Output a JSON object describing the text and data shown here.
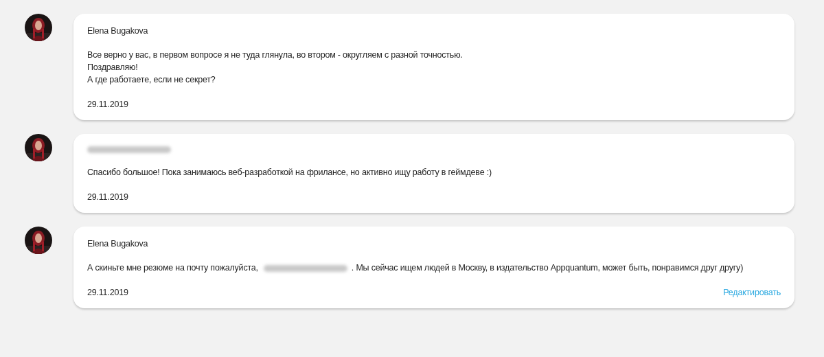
{
  "comments": [
    {
      "author": {
        "kind": "name",
        "text": "Elena Bugakova"
      },
      "lines": [
        [
          {
            "kind": "text",
            "text": "Все верно у вас, в первом вопросе я не туда глянула, во втором - округляем с разной точностью."
          }
        ],
        [
          {
            "kind": "text",
            "text": "Поздравляю!"
          }
        ],
        [
          {
            "kind": "text",
            "text": "А где работаете, если не секрет?"
          }
        ]
      ],
      "date": "29.11.2019"
    },
    {
      "author": {
        "kind": "redacted"
      },
      "lines": [
        [
          {
            "kind": "text",
            "text": "Спасибо большое! Пока занимаюсь веб-разработкой на фрилансе, но активно ищу работу в геймдеве :)"
          }
        ]
      ],
      "date": "29.11.2019"
    },
    {
      "author": {
        "kind": "name",
        "text": "Elena Bugakova"
      },
      "lines": [
        [
          {
            "kind": "text",
            "text": "А скиньте мне резюме на почту пожалуйста,"
          },
          {
            "kind": "redacted"
          },
          {
            "kind": "text",
            "text": ". Мы сейчас ищем людей в Москву, в издательство Appquantum, может быть, понравимся друг другу)"
          }
        ]
      ],
      "date": "29.11.2019",
      "edit_link": "Редактировать"
    }
  ]
}
